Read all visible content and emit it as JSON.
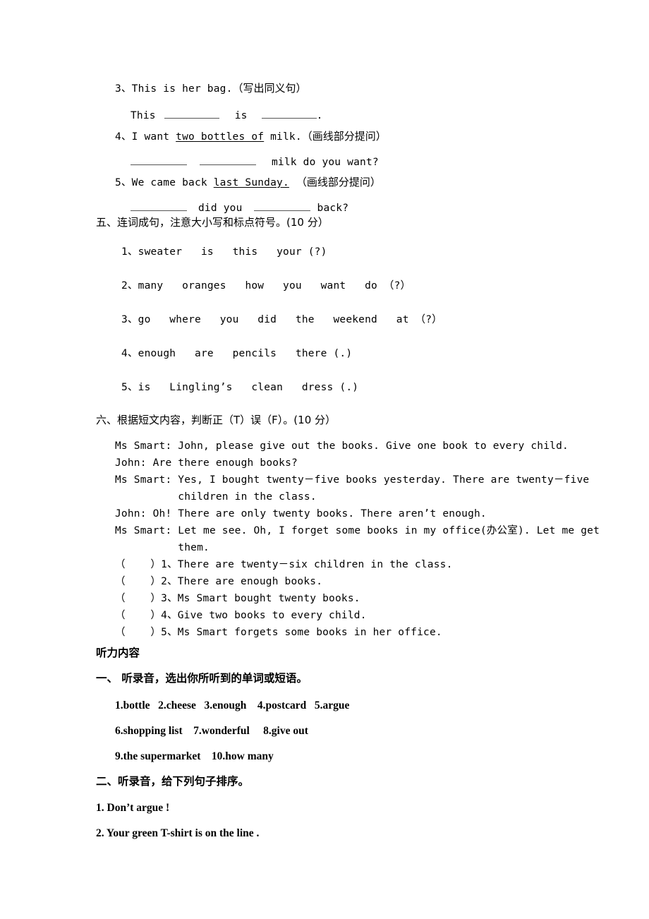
{
  "document": {
    "type": "exam-paper",
    "language": "zh-CN + en",
    "page_background": "#ffffff",
    "text_color": "#000000"
  },
  "section_four_tail": {
    "items": [
      {
        "number": "3、",
        "sentence": "This is her bag.",
        "instruction": "（写出同义句）",
        "answer_line_pre": "This",
        "answer_line_mid": "is",
        "answer_line_end": "."
      },
      {
        "number": "4、",
        "prefix": "I want ",
        "underlined": "two bottles of",
        "suffix": " milk.",
        "instruction": "（画线部分提问）",
        "answer_line_tail": "milk do you want?"
      },
      {
        "number": "5、",
        "prefix": "We came back ",
        "underlined": "last Sunday.",
        "suffix": "",
        "instruction": "（画线部分提问）",
        "answer_line_mid": "did you",
        "answer_line_tail": "back?"
      }
    ]
  },
  "section_five": {
    "heading": "五、连词成句，注意大小写和标点符号。(10 分）",
    "items": [
      {
        "number": "1、",
        "text": "sweater   is   this   your (?)"
      },
      {
        "number": "2、",
        "text": "many   oranges   how   you   want   do （?）"
      },
      {
        "number": "3、",
        "text": "go   where   you   did   the   weekend   at （?）"
      },
      {
        "number": "4、",
        "text": "enough   are   pencils   there (.)"
      },
      {
        "number": "5、",
        "text": "is   Lingling’s   clean   dress (.)"
      }
    ]
  },
  "section_six": {
    "heading": "六、根据短文内容，判断正（T）误（F）。(10 分）",
    "dialogue": [
      "Ms Smart: John, please give out the books. Give one book to every child.",
      "John: Are there enough books?",
      "Ms Smart: Yes, I bought twenty－five books yesterday. There are twenty－five",
      "          children in the class.",
      "John: Oh! There are only twenty books. There aren’t enough.",
      "Ms Smart: Let me see. Oh, I forget some books in my office(办公室). Let me get",
      "          them."
    ],
    "tf_items": [
      "（    ）1、There are twenty－six children in the class.",
      "（    ）2、There are enough books.",
      "（    ）3、Ms Smart bought twenty books.",
      "（    ）4、Give two books to every child.",
      "（    ）5、Ms Smart forgets some books in her office."
    ]
  },
  "listening": {
    "title": "听力内容",
    "part_one": {
      "heading": "一、 听录音，选出你所听到的单词或短语。",
      "word_rows": [
        "1.bottle   2.cheese   3.enough    4.postcard   5.argue",
        "6.shopping list    7.wonderful     8.give out",
        "9.the supermarket    10.how many"
      ]
    },
    "part_two": {
      "heading": "二、听录音，给下列句子排序。",
      "sentences": [
        "1. Don’t argue !",
        "2. Your green T-shirt is on the line ."
      ]
    }
  }
}
